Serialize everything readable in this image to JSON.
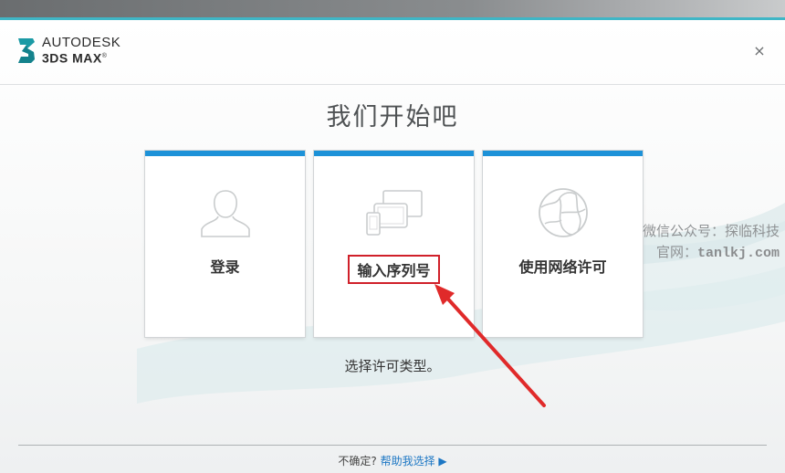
{
  "brand": {
    "line1": "AUTODESK",
    "line2": "3DS MAX",
    "reg": "®"
  },
  "window": {
    "close_glyph": "×"
  },
  "main": {
    "title": "我们开始吧",
    "cards": [
      {
        "label": "登录",
        "icon": "user-icon"
      },
      {
        "label": "输入序列号",
        "icon": "devices-icon"
      },
      {
        "label": "使用网络许可",
        "icon": "network-globe-icon"
      }
    ],
    "prompt": "选择许可类型。"
  },
  "watermark": {
    "line1": "微信公众号：探临科技",
    "line2_prefix": "官网：",
    "line2_url": "tanlkj.com"
  },
  "footer": {
    "question": "不确定?",
    "help_link": "帮助我选择",
    "help_arrow": "▶"
  },
  "colors": {
    "accent_blue": "#1d92d8",
    "highlight_red": "#d0202a",
    "arrow_red": "#e02a2a",
    "titlebar_teal": "#3fb6c6"
  }
}
